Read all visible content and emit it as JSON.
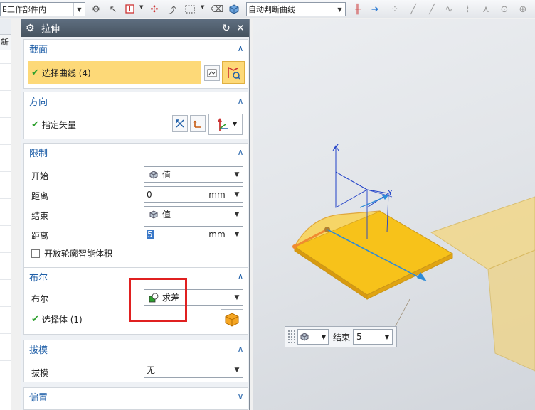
{
  "toolbar": {
    "filter_value": "E工作部件内",
    "curve_rule_value": "自动判断曲线"
  },
  "navigator": {
    "header_label": "新"
  },
  "dialog": {
    "title": "拉伸",
    "section": {
      "title": "截面",
      "select_label": "选择曲线 (4)"
    },
    "direction": {
      "title": "方向",
      "vector_label": "指定矢量"
    },
    "limits": {
      "title": "限制",
      "start_label": "开始",
      "start_value": "值",
      "distance1_label": "距离",
      "distance1_value": "0",
      "distance1_unit": "mm",
      "end_label": "结束",
      "end_value": "值",
      "distance2_label": "距离",
      "distance2_value": "5",
      "distance2_unit": "mm",
      "open_profile_label": "开放轮廓智能体积"
    },
    "boolean": {
      "title": "布尔",
      "bool_label": "布尔",
      "bool_value": "求差",
      "select_body_label": "选择体 (1)"
    },
    "draft": {
      "title": "拔模",
      "draft_label": "拔模",
      "draft_value": "无"
    },
    "offset": {
      "title": "偏置"
    }
  },
  "viewport": {
    "axis_z": "Z",
    "axis_y": "Y",
    "float_end_label": "结束",
    "float_end_value": "5"
  },
  "colors": {
    "accent": "#1f5fa8",
    "highlight": "#fdd978",
    "part": "#f5c21b",
    "annotation": "#e02020"
  }
}
